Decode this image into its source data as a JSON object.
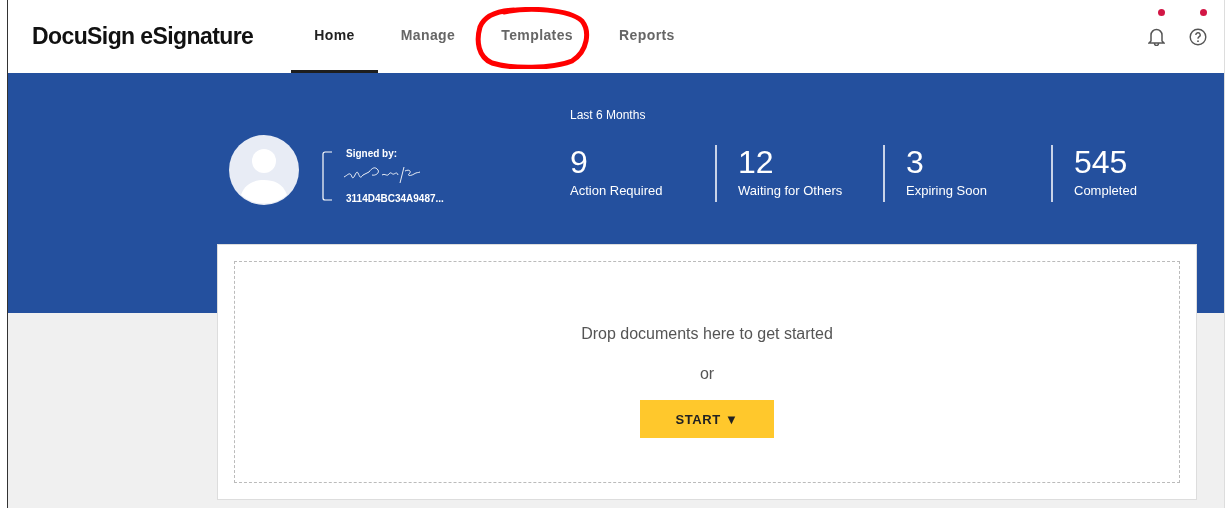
{
  "header": {
    "logo": "DocuSign",
    "logo_suffix": "eSignature",
    "tabs": [
      {
        "label": "Home",
        "selected": true,
        "circled": false
      },
      {
        "label": "Manage",
        "selected": false,
        "circled": false
      },
      {
        "label": "Templates",
        "selected": false,
        "circled": true
      },
      {
        "label": "Reports",
        "selected": false,
        "circled": false
      }
    ],
    "notifications_dot": true,
    "help_dot": true
  },
  "profile": {
    "signed_by_label": "Signed by:",
    "signature_id": "3114D4BC34A9487..."
  },
  "stats": {
    "period": "Last 6 Months",
    "items": [
      {
        "value": "9",
        "label": "Action Required"
      },
      {
        "value": "12",
        "label": "Waiting for Others"
      },
      {
        "value": "3",
        "label": "Expiring Soon"
      },
      {
        "value": "545",
        "label": "Completed"
      }
    ]
  },
  "dropzone": {
    "message": "Drop documents here to get started",
    "or": "or",
    "start_button": "START",
    "start_caret": "▼"
  }
}
